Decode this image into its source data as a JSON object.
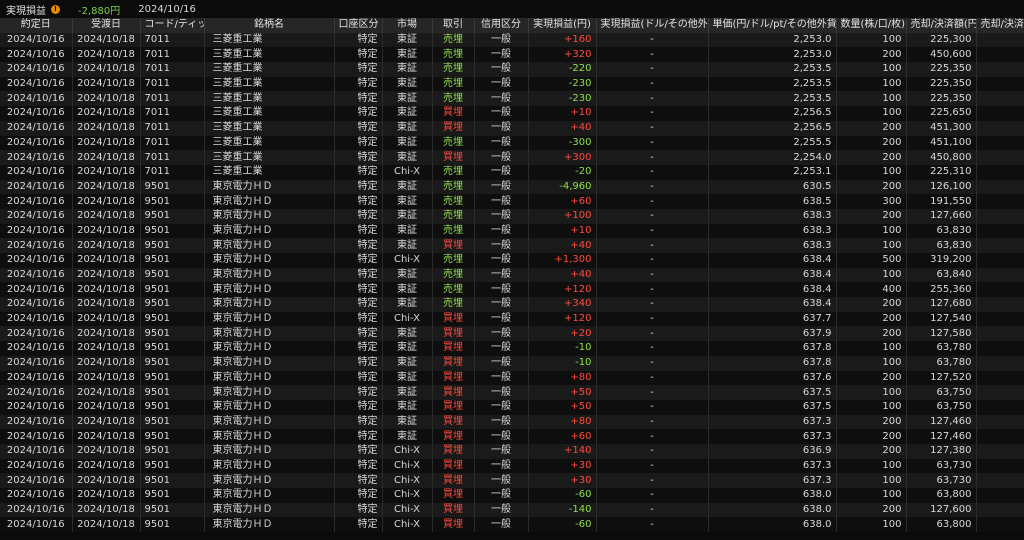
{
  "summary": {
    "label": "実現損益",
    "warning_icon_glyph": "!",
    "total": "-2,880円",
    "date": "2024/10/16"
  },
  "columns": [
    "約定日",
    "受渡日",
    "コード/ティッカー",
    "銘柄名",
    "口座区分",
    "市場",
    "取引",
    "信用区分",
    "実現損益(円)",
    "実現損益(ドル/その他外貨)",
    "単価(円/ドル/pt/その他外貨)",
    "数量(株/口/枚)",
    "売却/決済額(円)",
    "売却/決済額(ドル/その他外貨)"
  ],
  "rows": [
    [
      "2024/10/16",
      "2024/10/18",
      "7011",
      "三菱重工業",
      "特定",
      "東証",
      "売埋",
      "一般",
      "+160",
      "-",
      "2,253.0",
      "100",
      "225,300"
    ],
    [
      "2024/10/16",
      "2024/10/18",
      "7011",
      "三菱重工業",
      "特定",
      "東証",
      "売埋",
      "一般",
      "+320",
      "-",
      "2,253.0",
      "200",
      "450,600"
    ],
    [
      "2024/10/16",
      "2024/10/18",
      "7011",
      "三菱重工業",
      "特定",
      "東証",
      "売埋",
      "一般",
      "-220",
      "-",
      "2,253.5",
      "100",
      "225,350"
    ],
    [
      "2024/10/16",
      "2024/10/18",
      "7011",
      "三菱重工業",
      "特定",
      "東証",
      "売埋",
      "一般",
      "-230",
      "-",
      "2,253.5",
      "100",
      "225,350"
    ],
    [
      "2024/10/16",
      "2024/10/18",
      "7011",
      "三菱重工業",
      "特定",
      "東証",
      "売埋",
      "一般",
      "-230",
      "-",
      "2,253.5",
      "100",
      "225,350"
    ],
    [
      "2024/10/16",
      "2024/10/18",
      "7011",
      "三菱重工業",
      "特定",
      "東証",
      "買埋",
      "一般",
      "+10",
      "-",
      "2,256.5",
      "100",
      "225,650"
    ],
    [
      "2024/10/16",
      "2024/10/18",
      "7011",
      "三菱重工業",
      "特定",
      "東証",
      "買埋",
      "一般",
      "+40",
      "-",
      "2,256.5",
      "200",
      "451,300"
    ],
    [
      "2024/10/16",
      "2024/10/18",
      "7011",
      "三菱重工業",
      "特定",
      "東証",
      "売埋",
      "一般",
      "-300",
      "-",
      "2,255.5",
      "200",
      "451,100"
    ],
    [
      "2024/10/16",
      "2024/10/18",
      "7011",
      "三菱重工業",
      "特定",
      "東証",
      "買埋",
      "一般",
      "+300",
      "-",
      "2,254.0",
      "200",
      "450,800"
    ],
    [
      "2024/10/16",
      "2024/10/18",
      "7011",
      "三菱重工業",
      "特定",
      "Chi-X",
      "売埋",
      "一般",
      "-20",
      "-",
      "2,253.1",
      "100",
      "225,310"
    ],
    [
      "2024/10/16",
      "2024/10/18",
      "9501",
      "東京電力ＨＤ",
      "特定",
      "東証",
      "売埋",
      "一般",
      "-4,960",
      "-",
      "630.5",
      "200",
      "126,100"
    ],
    [
      "2024/10/16",
      "2024/10/18",
      "9501",
      "東京電力ＨＤ",
      "特定",
      "東証",
      "売埋",
      "一般",
      "+60",
      "-",
      "638.5",
      "300",
      "191,550"
    ],
    [
      "2024/10/16",
      "2024/10/18",
      "9501",
      "東京電力ＨＤ",
      "特定",
      "東証",
      "売埋",
      "一般",
      "+100",
      "-",
      "638.3",
      "200",
      "127,660"
    ],
    [
      "2024/10/16",
      "2024/10/18",
      "9501",
      "東京電力ＨＤ",
      "特定",
      "東証",
      "売埋",
      "一般",
      "+10",
      "-",
      "638.3",
      "100",
      "63,830"
    ],
    [
      "2024/10/16",
      "2024/10/18",
      "9501",
      "東京電力ＨＤ",
      "特定",
      "東証",
      "買埋",
      "一般",
      "+40",
      "-",
      "638.3",
      "100",
      "63,830"
    ],
    [
      "2024/10/16",
      "2024/10/18",
      "9501",
      "東京電力ＨＤ",
      "特定",
      "Chi-X",
      "売埋",
      "一般",
      "+1,300",
      "-",
      "638.4",
      "500",
      "319,200"
    ],
    [
      "2024/10/16",
      "2024/10/18",
      "9501",
      "東京電力ＨＤ",
      "特定",
      "東証",
      "売埋",
      "一般",
      "+40",
      "-",
      "638.4",
      "100",
      "63,840"
    ],
    [
      "2024/10/16",
      "2024/10/18",
      "9501",
      "東京電力ＨＤ",
      "特定",
      "東証",
      "売埋",
      "一般",
      "+120",
      "-",
      "638.4",
      "400",
      "255,360"
    ],
    [
      "2024/10/16",
      "2024/10/18",
      "9501",
      "東京電力ＨＤ",
      "特定",
      "東証",
      "売埋",
      "一般",
      "+340",
      "-",
      "638.4",
      "200",
      "127,680"
    ],
    [
      "2024/10/16",
      "2024/10/18",
      "9501",
      "東京電力ＨＤ",
      "特定",
      "Chi-X",
      "買埋",
      "一般",
      "+120",
      "-",
      "637.7",
      "200",
      "127,540"
    ],
    [
      "2024/10/16",
      "2024/10/18",
      "9501",
      "東京電力ＨＤ",
      "特定",
      "東証",
      "買埋",
      "一般",
      "+20",
      "-",
      "637.9",
      "200",
      "127,580"
    ],
    [
      "2024/10/16",
      "2024/10/18",
      "9501",
      "東京電力ＨＤ",
      "特定",
      "東証",
      "買埋",
      "一般",
      "-10",
      "-",
      "637.8",
      "100",
      "63,780"
    ],
    [
      "2024/10/16",
      "2024/10/18",
      "9501",
      "東京電力ＨＤ",
      "特定",
      "東証",
      "買埋",
      "一般",
      "-10",
      "-",
      "637.8",
      "100",
      "63,780"
    ],
    [
      "2024/10/16",
      "2024/10/18",
      "9501",
      "東京電力ＨＤ",
      "特定",
      "東証",
      "買埋",
      "一般",
      "+80",
      "-",
      "637.6",
      "200",
      "127,520"
    ],
    [
      "2024/10/16",
      "2024/10/18",
      "9501",
      "東京電力ＨＤ",
      "特定",
      "東証",
      "買埋",
      "一般",
      "+50",
      "-",
      "637.5",
      "100",
      "63,750"
    ],
    [
      "2024/10/16",
      "2024/10/18",
      "9501",
      "東京電力ＨＤ",
      "特定",
      "東証",
      "買埋",
      "一般",
      "+50",
      "-",
      "637.5",
      "100",
      "63,750"
    ],
    [
      "2024/10/16",
      "2024/10/18",
      "9501",
      "東京電力ＨＤ",
      "特定",
      "東証",
      "買埋",
      "一般",
      "+80",
      "-",
      "637.3",
      "200",
      "127,460"
    ],
    [
      "2024/10/16",
      "2024/10/18",
      "9501",
      "東京電力ＨＤ",
      "特定",
      "東証",
      "買埋",
      "一般",
      "+60",
      "-",
      "637.3",
      "200",
      "127,460"
    ],
    [
      "2024/10/16",
      "2024/10/18",
      "9501",
      "東京電力ＨＤ",
      "特定",
      "Chi-X",
      "買埋",
      "一般",
      "+140",
      "-",
      "636.9",
      "200",
      "127,380"
    ],
    [
      "2024/10/16",
      "2024/10/18",
      "9501",
      "東京電力ＨＤ",
      "特定",
      "Chi-X",
      "買埋",
      "一般",
      "+30",
      "-",
      "637.3",
      "100",
      "63,730"
    ],
    [
      "2024/10/16",
      "2024/10/18",
      "9501",
      "東京電力ＨＤ",
      "特定",
      "Chi-X",
      "買埋",
      "一般",
      "+30",
      "-",
      "637.3",
      "100",
      "63,730"
    ],
    [
      "2024/10/16",
      "2024/10/18",
      "9501",
      "東京電力ＨＤ",
      "特定",
      "Chi-X",
      "買埋",
      "一般",
      "-60",
      "-",
      "638.0",
      "100",
      "63,800"
    ],
    [
      "2024/10/16",
      "2024/10/18",
      "9501",
      "東京電力ＨＤ",
      "特定",
      "Chi-X",
      "買埋",
      "一般",
      "-140",
      "-",
      "638.0",
      "200",
      "127,600"
    ],
    [
      "2024/10/16",
      "2024/10/18",
      "9501",
      "東京電力ＨＤ",
      "特定",
      "Chi-X",
      "買埋",
      "一般",
      "-60",
      "-",
      "638.0",
      "100",
      "63,800"
    ]
  ],
  "colors": {
    "background": "#0b0b0b",
    "header_bg": "#262626",
    "row_odd": "#1a1a1a",
    "row_even": "#0e0e0e",
    "positive": "#ff4a3a",
    "negative": "#8fe04c",
    "sell": "#8fe04c",
    "buy": "#ff4a3a",
    "warning": "#e8890c"
  }
}
